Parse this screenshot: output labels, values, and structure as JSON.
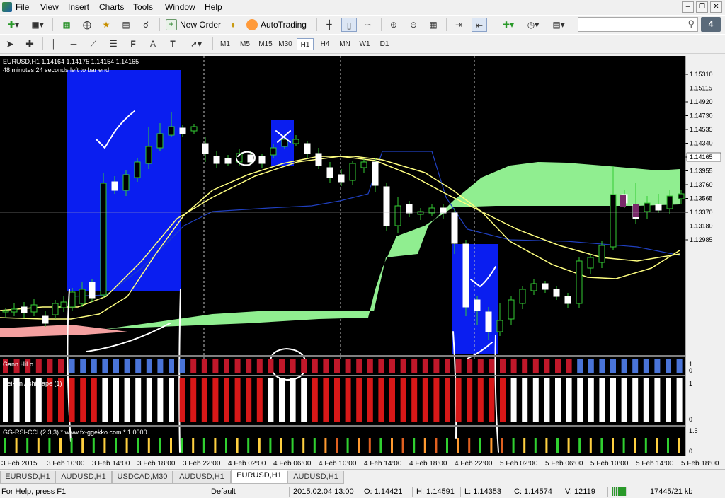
{
  "menu": {
    "items": [
      "File",
      "View",
      "Insert",
      "Charts",
      "Tools",
      "Window",
      "Help"
    ]
  },
  "toolbar": {
    "new_order_label": "New Order",
    "autotrading_label": "AutoTrading"
  },
  "timeframes": [
    "M1",
    "M5",
    "M15",
    "M30",
    "H1",
    "H4",
    "MN",
    "W1",
    "D1"
  ],
  "selected_timeframe": "H1",
  "chart": {
    "info_line": "EURUSD,H1  1.14164 1.14175 1.14154 1.14165",
    "countdown": "48 minutes 24 seconds left to bar end",
    "price_labels": [
      "1.15310",
      "1.15115",
      "1.14920",
      "1.14730",
      "1.14535",
      "1.14340",
      "1.14165",
      "1.13955",
      "1.13760",
      "1.13565",
      "1.13370",
      "1.13180",
      "1.12985"
    ],
    "current_price": "1.14165",
    "time_labels": [
      "3 Feb 2015",
      "3 Feb 10:00",
      "3 Feb 14:00",
      "3 Feb 18:00",
      "3 Feb 22:00",
      "4 Feb 02:00",
      "4 Feb 06:00",
      "4 Feb 10:00",
      "4 Feb 14:00",
      "4 Feb 18:00",
      "4 Feb 22:00",
      "5 Feb 02:00",
      "5 Feb 06:00",
      "5 Feb 10:00",
      "5 Feb 14:00",
      "5 Feb 18:00"
    ],
    "colors": {
      "background": "#000000",
      "bull": "#ffffff",
      "bear": "#ffffff",
      "wick": "#33cc33",
      "cloud_bull": "#90ee90",
      "cloud_bear": "#f4a0a0",
      "ma": "#ffff80",
      "kijun": "#2040c0",
      "highlight": "#0a1ef0"
    }
  },
  "indicators": {
    "gann": {
      "label": "Gann HiLo",
      "scale": [
        "1",
        "0"
      ]
    },
    "heiken": {
      "label": "Heiken Ashi-Tape (1)",
      "scale": [
        "1",
        "0"
      ]
    },
    "rsi": {
      "label": "GG-RSI-CCI (2,3,3) * www.fx-ggekko.com *  1.0000",
      "scale": [
        "1.5",
        "0"
      ]
    }
  },
  "tabs": [
    {
      "label": "EURUSD,H1",
      "active": false
    },
    {
      "label": "AUDUSD,H1",
      "active": false
    },
    {
      "label": "USDCAD,M30",
      "active": false
    },
    {
      "label": "AUDUSD,H1",
      "active": false
    },
    {
      "label": "EURUSD,H1",
      "active": true
    },
    {
      "label": "AUDUSD,H1",
      "active": false
    }
  ],
  "status": {
    "help": "For Help, press F1",
    "profile": "Default",
    "datetime": "2015.02.04 13:00",
    "open": "O: 1.14421",
    "high": "H: 1.14591",
    "low": "L: 1.14353",
    "close": "C: 1.14574",
    "volume": "V: 12119",
    "traffic": "17445/21 kb"
  },
  "chart_data": {
    "type": "candlestick",
    "symbol": "EURUSD",
    "timeframe": "H1",
    "ylim": [
      1.12985,
      1.1531
    ],
    "x": [
      "3 Feb 2015",
      "3 Feb 10:00",
      "3 Feb 14:00",
      "3 Feb 18:00",
      "3 Feb 22:00",
      "4 Feb 02:00",
      "4 Feb 06:00",
      "4 Feb 10:00",
      "4 Feb 14:00",
      "4 Feb 18:00",
      "4 Feb 22:00",
      "5 Feb 02:00",
      "5 Feb 06:00",
      "5 Feb 10:00",
      "5 Feb 14:00",
      "5 Feb 18:00"
    ],
    "current_price": 1.14165,
    "bar_ohlc": {
      "time": "2015.02.04 13:00",
      "open": 1.14421,
      "high": 1.14591,
      "low": 1.14353,
      "close": 1.14574,
      "volume": 12119
    }
  }
}
